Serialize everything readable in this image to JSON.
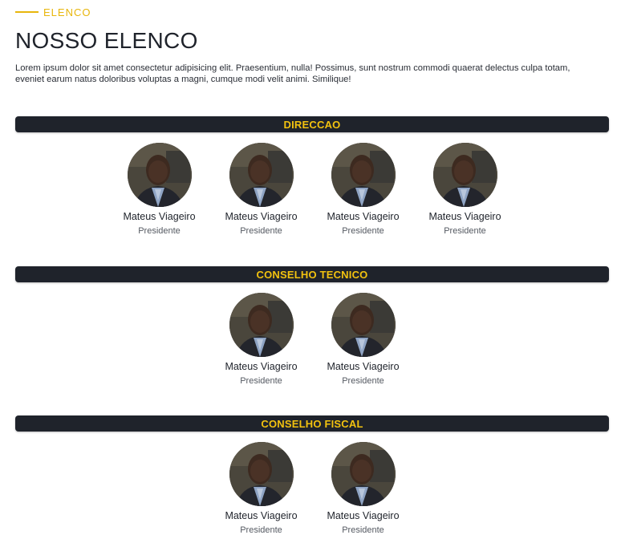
{
  "header": {
    "eyebrow": "ELENCO",
    "title": "NOSSO ELENCO",
    "intro": "Lorem ipsum dolor sit amet consectetur adipisicing elit. Praesentium, nulla! Possimus, sunt nostrum commodi quaerat delectus culpa totam, eveniet earum natus doloribus voluptas a magni, cumque modi velit animi. Similique!"
  },
  "colors": {
    "accent": "#e8b60c",
    "bar": "#1f232b",
    "bar_text": "#f2c20f"
  },
  "sections": [
    {
      "label": "DIRECCAO",
      "members": [
        {
          "name": "Mateus Viageiro",
          "role": "Presidente"
        },
        {
          "name": "Mateus Viageiro",
          "role": "Presidente"
        },
        {
          "name": "Mateus Viageiro",
          "role": "Presidente"
        },
        {
          "name": "Mateus Viageiro",
          "role": "Presidente"
        }
      ]
    },
    {
      "label": "CONSELHO TECNICO",
      "members": [
        {
          "name": "Mateus Viageiro",
          "role": "Presidente"
        },
        {
          "name": "Mateus Viageiro",
          "role": "Presidente"
        }
      ]
    },
    {
      "label": "CONSELHO FISCAL",
      "members": [
        {
          "name": "Mateus Viageiro",
          "role": "Presidente"
        },
        {
          "name": "Mateus Viageiro",
          "role": "Presidente"
        }
      ]
    }
  ]
}
